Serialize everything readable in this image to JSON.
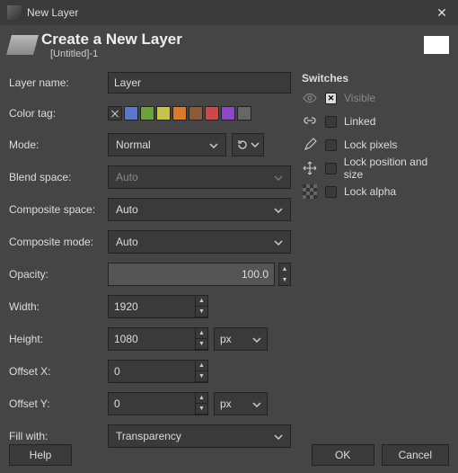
{
  "window": {
    "title": "New Layer"
  },
  "header": {
    "title": "Create a New Layer",
    "subtitle": "[Untitled]-1"
  },
  "form": {
    "layer_name_label": "Layer name:",
    "layer_name_value": "Layer",
    "color_tag_label": "Color tag:",
    "color_tags": [
      "none",
      "#5a78c8",
      "#6fa03f",
      "#c8c34a",
      "#d87b2a",
      "#8a5a3a",
      "#c84a4a",
      "#8a4ac8",
      "#666666"
    ],
    "mode_label": "Mode:",
    "mode_value": "Normal",
    "blend_space_label": "Blend space:",
    "blend_space_value": "Auto",
    "composite_space_label": "Composite space:",
    "composite_space_value": "Auto",
    "composite_mode_label": "Composite mode:",
    "composite_mode_value": "Auto",
    "opacity_label": "Opacity:",
    "opacity_value": "100.0",
    "width_label": "Width:",
    "width_value": "1920",
    "height_label": "Height:",
    "height_value": "1080",
    "height_unit": "px",
    "offset_x_label": "Offset X:",
    "offset_x_value": "0",
    "offset_y_label": "Offset Y:",
    "offset_y_value": "0",
    "offset_unit": "px",
    "fill_label": "Fill with:",
    "fill_value": "Transparency"
  },
  "switches": {
    "title": "Switches",
    "visible": {
      "label": "Visible",
      "checked": true
    },
    "linked": {
      "label": "Linked",
      "checked": false
    },
    "lock_pixels": {
      "label": "Lock pixels",
      "checked": false
    },
    "lock_position": {
      "label": "Lock position and size",
      "checked": false
    },
    "lock_alpha": {
      "label": "Lock alpha",
      "checked": false
    }
  },
  "buttons": {
    "help": "Help",
    "ok": "OK",
    "cancel": "Cancel"
  }
}
